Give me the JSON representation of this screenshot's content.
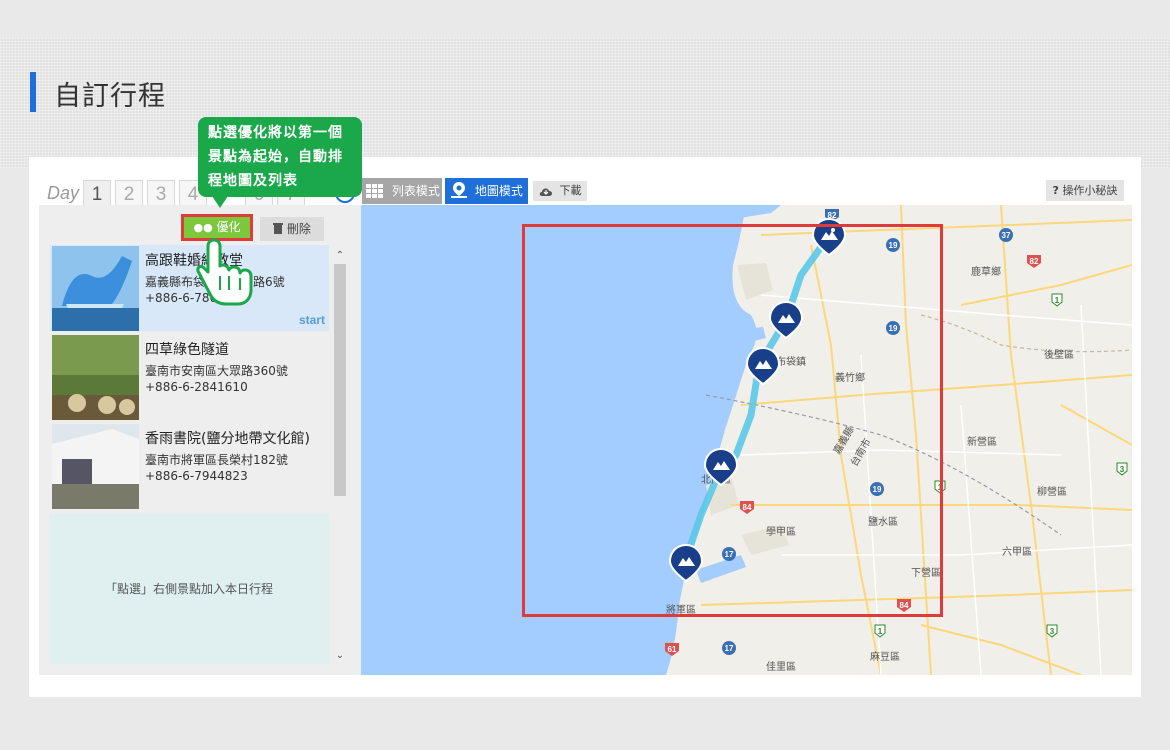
{
  "page": {
    "title": "自訂行程"
  },
  "day_tabs": {
    "label": "Day",
    "tabs": [
      "1",
      "2",
      "3",
      "4",
      "5",
      "6",
      "7"
    ],
    "active": "1",
    "info": "i"
  },
  "toolbar": {
    "optimize_label": "優化",
    "delete_label": "刪除",
    "list_mode_label": "列表模式",
    "map_mode_label": "地圖模式",
    "download_label": "下載",
    "tips_label": "操作小秘訣"
  },
  "tooltip": {
    "text": "點選優化將以第一個景點為起始，自動排程地圖及列表"
  },
  "itinerary": [
    {
      "name": "高跟鞋婚紗教堂",
      "address": "嘉義縣布袋鎮新塭興路6號",
      "phone": "+886-6-7861000",
      "tag": "start"
    },
    {
      "name": "四草綠色隧道",
      "address": "臺南市安南區大眾路360號",
      "phone": "+886-6-2841610",
      "tag": ""
    },
    {
      "name": "香雨書院(鹽分地帶文化館)",
      "address": "臺南市將軍區長榮村182號",
      "phone": "+886-6-7944823",
      "tag": ""
    }
  ],
  "dropzone": {
    "text": "「點選」右側景點加入本日行程"
  },
  "map": {
    "labels": {
      "yizhu": "義竹鄉",
      "lucao": "鹿草鄉",
      "houbi": "後壁區",
      "xinying": "新營區",
      "liuying": "柳營區",
      "yanshui": "鹽水區",
      "xuejia": "學甲區",
      "liujia": "六甲區",
      "xiaying": "下營區",
      "jiangjun": "將軍區",
      "jiali": "佳里區",
      "madou": "麻豆區",
      "budai": "布袋鎮",
      "beimen": "北門區",
      "jiayi_county": "嘉義縣",
      "tainan_city": "台南市"
    },
    "route_color": "#5bc8e8",
    "pin_color": "#1a3f8a"
  },
  "colors": {
    "accent": "#1e6fd9",
    "optimize": "#7cc73c",
    "highlight": "#e03b3b",
    "tooltip": "#1aa84a"
  }
}
